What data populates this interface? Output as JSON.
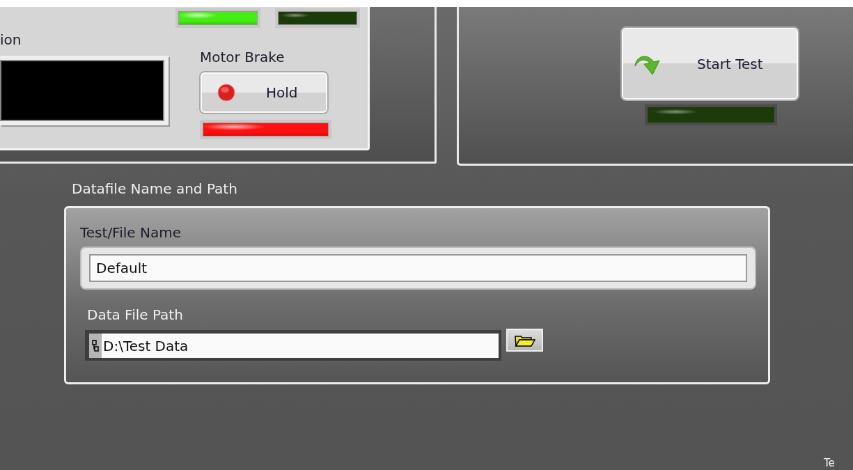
{
  "status_panel": {
    "display_label": "ion",
    "leds": [
      {
        "color": "#44ee11",
        "on": true
      },
      {
        "color": "#1c3a0a",
        "on": false
      }
    ],
    "motor_brake": {
      "label": "Motor Brake",
      "button": "Hold",
      "led": {
        "color": "#ff1010",
        "on": true
      }
    }
  },
  "test_panel": {
    "button": "Start Test",
    "led": {
      "color": "#1c3a0a",
      "on": false
    }
  },
  "datafile": {
    "title": "Datafile Name and Path",
    "name_label": "Test/File Name",
    "name_value": "Default",
    "path_label": "Data File Path",
    "path_value": "D:\\Test Data"
  },
  "corner_label": "Te"
}
